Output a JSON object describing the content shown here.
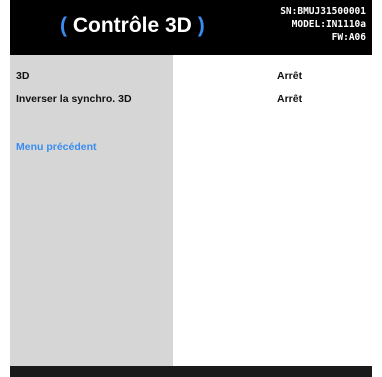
{
  "header": {
    "title_open": "(",
    "title_text": " Contrôle 3D ",
    "title_close": ")",
    "serial": "SN:BMUJ31500001",
    "model": "MODEL:IN1110a",
    "firmware": "FW:A06"
  },
  "menu": {
    "items": [
      {
        "label": "3D",
        "value": "Arrêt"
      },
      {
        "label": "Inverser la synchro. 3D",
        "value": "Arrêt"
      }
    ],
    "back_label": "Menu précédent"
  },
  "colors": {
    "accent": "#3a8df0",
    "header_bg": "#000000",
    "left_panel_bg": "#d6d6d6",
    "right_panel_bg": "#ffffff"
  }
}
